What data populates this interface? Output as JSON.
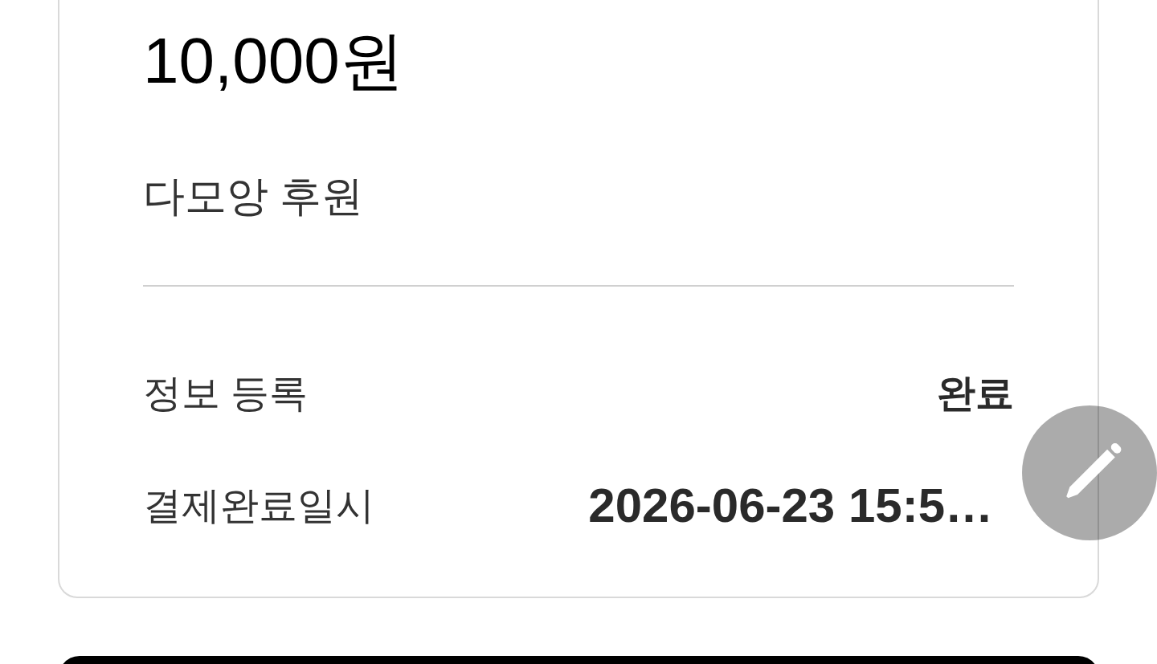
{
  "donation": {
    "amount": "10,000원",
    "description": "다모앙 후원"
  },
  "details": [
    {
      "label": "정보 등록",
      "value": "완료"
    },
    {
      "label": "결제완료일시",
      "value": "2026-06-23 15:5…"
    }
  ]
}
